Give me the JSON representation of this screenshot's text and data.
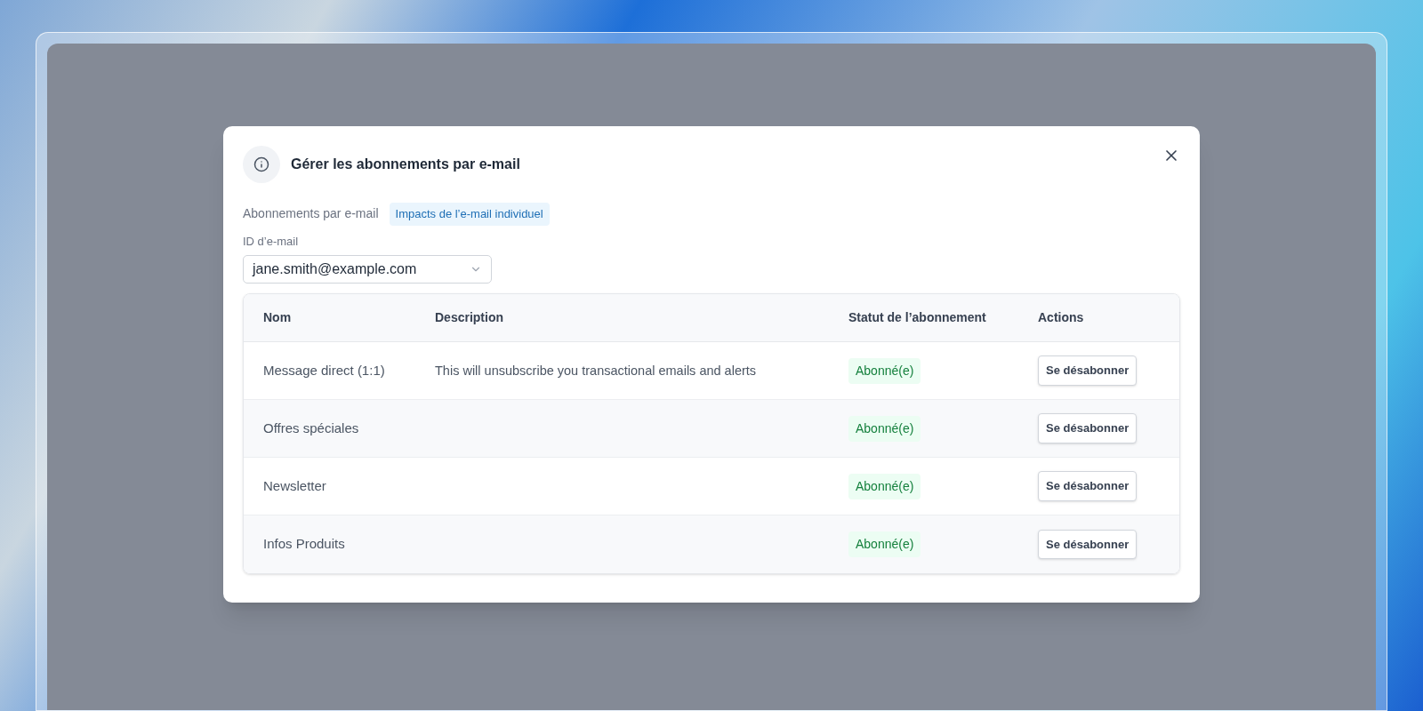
{
  "dialog": {
    "title": "Gérer les abonnements par e-mail",
    "subtitle": "Abonnements par e-mail",
    "tag": "Impacts de l’e-mail individuel",
    "email_field": {
      "label": "ID d’e-mail",
      "value": "jane.smith@example.com"
    },
    "table": {
      "columns": [
        "Nom",
        "Description",
        "Statut de l’abonnement",
        "Actions"
      ],
      "rows": [
        {
          "name": "Message direct (1:1)",
          "description": "This will unsubscribe you transactional emails and alerts",
          "status": "Abonné(e)",
          "action": "Se désabonner"
        },
        {
          "name": "Offres spéciales",
          "status": "Abonné(e)",
          "action": "Se désabonner"
        },
        {
          "name": "Newsletter",
          "status": "Abonné(e)",
          "action": "Se désabonner"
        },
        {
          "name": "Infos Produits",
          "status": "Abonné(e)",
          "action": "Se désabonner"
        }
      ]
    }
  }
}
